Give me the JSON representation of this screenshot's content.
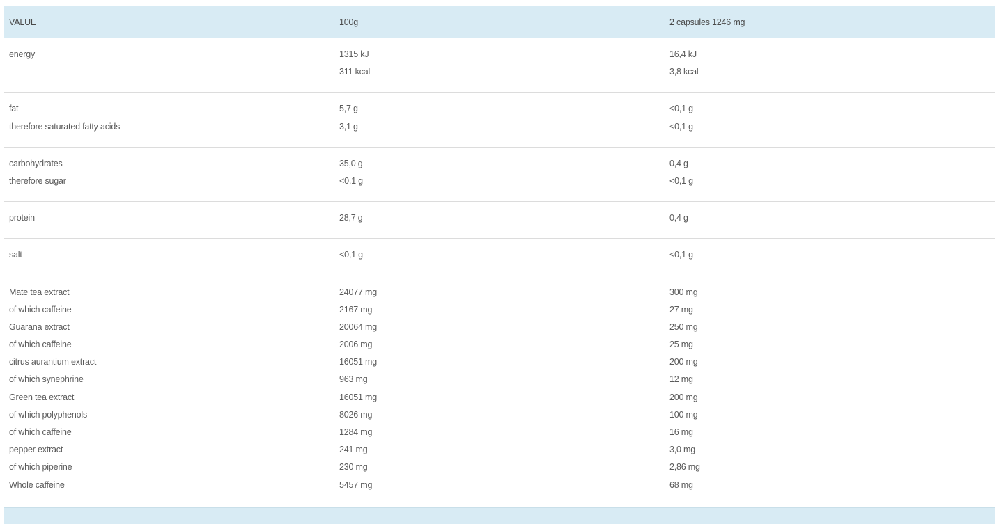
{
  "header": {
    "col1": "VALUE",
    "col2": "100g",
    "col3": "2 capsules 1246 mg"
  },
  "groups": [
    {
      "rows": [
        {
          "label": "energy",
          "per100": "1315 kJ",
          "perServing": "16,4 kJ"
        },
        {
          "label": "",
          "per100": "311 kcal",
          "perServing": "3,8 kcal"
        }
      ]
    },
    {
      "rows": [
        {
          "label": "fat",
          "per100": "5,7 g",
          "perServing": "<0,1 g"
        },
        {
          "label": "therefore saturated fatty acids",
          "per100": "3,1 g",
          "perServing": "<0,1 g"
        }
      ]
    },
    {
      "rows": [
        {
          "label": "carbohydrates",
          "per100": "35,0 g",
          "perServing": "0,4 g"
        },
        {
          "label": "therefore sugar",
          "per100": "<0,1 g",
          "perServing": "<0,1 g"
        }
      ]
    },
    {
      "rows": [
        {
          "label": "protein",
          "per100": "28,7 g",
          "perServing": "0,4 g"
        }
      ]
    },
    {
      "rows": [
        {
          "label": "salt",
          "per100": "<0,1 g",
          "perServing": "<0,1 g"
        }
      ]
    },
    {
      "rows": [
        {
          "label": "Mate tea extract",
          "per100": "24077 mg",
          "perServing": "300 mg"
        },
        {
          "label": "of which caffeine",
          "per100": "2167 mg",
          "perServing": "27 mg"
        },
        {
          "label": "Guarana extract",
          "per100": "20064 mg",
          "perServing": "250 mg"
        },
        {
          "label": "of which caffeine",
          "per100": "2006 mg",
          "perServing": "25 mg"
        },
        {
          "label": "citrus aurantium extract",
          "per100": "16051 mg",
          "perServing": "200 mg"
        },
        {
          "label": "of which synephrine",
          "per100": "963 mg",
          "perServing": "12 mg"
        },
        {
          "label": "Green tea extract",
          "per100": "16051 mg",
          "perServing": "200 mg"
        },
        {
          "label": "of which polyphenols",
          "per100": "8026 mg",
          "perServing": "100 mg"
        },
        {
          "label": "of which caffeine",
          "per100": "1284 mg",
          "perServing": "16 mg"
        },
        {
          "label": "pepper extract",
          "per100": "241 mg",
          "perServing": "3,0 mg"
        },
        {
          "label": "of which piperine",
          "per100": "230 mg",
          "perServing": "2,86 mg"
        },
        {
          "label": "Whole caffeine",
          "per100": "5457 mg",
          "perServing": "68 mg"
        }
      ]
    }
  ]
}
